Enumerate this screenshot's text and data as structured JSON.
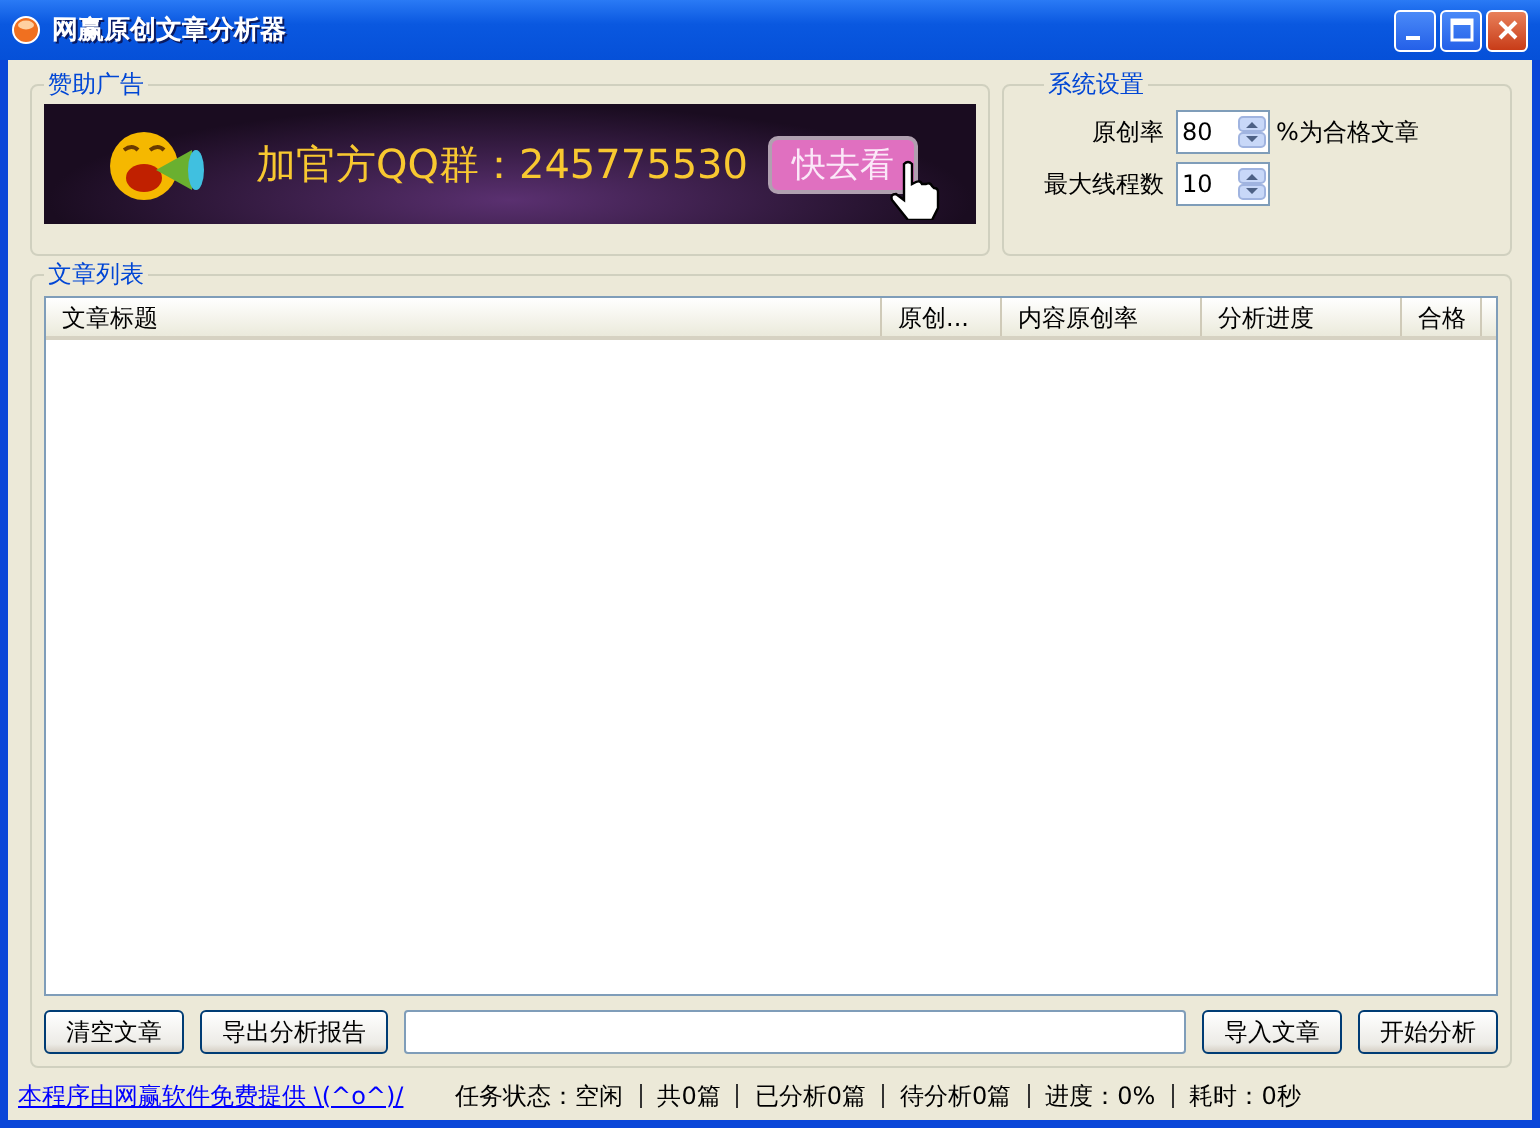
{
  "window": {
    "title": "网赢原创文章分析器"
  },
  "ad_group": {
    "title": "赞助广告",
    "banner_text": "加官方QQ群：245775530",
    "banner_button": "快去看"
  },
  "settings": {
    "title": "系统设置",
    "fields": [
      {
        "label": "原创率",
        "value": "80",
        "suffix": "%为合格文章"
      },
      {
        "label": "最大线程数",
        "value": "10"
      }
    ]
  },
  "article_list": {
    "title": "文章列表",
    "columns": [
      "文章标题",
      "原创...",
      "内容原创率",
      "分析进度",
      "合格"
    ]
  },
  "buttons_left": [
    "清空文章",
    "导出分析报告"
  ],
  "buttons_right": [
    "导入文章",
    "开始分析"
  ],
  "status_bar": {
    "link": "本程序由网赢软件免费提供 \\(^o^)/",
    "items": [
      "任务状态：空闲",
      "共0篇",
      "已分析0篇",
      "待分析0篇",
      "进度：0%",
      "耗时：0秒"
    ]
  }
}
